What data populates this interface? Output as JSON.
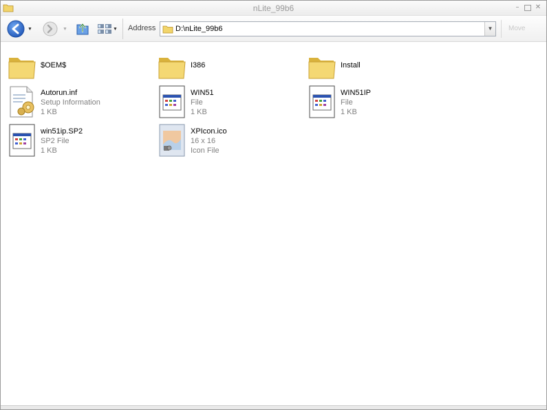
{
  "window": {
    "title": "nLite_99b6"
  },
  "toolbar": {
    "address_label": "Address",
    "address_value": "D:\\nLite_99b6",
    "go_label": "Move"
  },
  "files": [
    {
      "name": "$OEM$",
      "type": "",
      "size": "",
      "icon": "folder-icon"
    },
    {
      "name": "I386",
      "type": "",
      "size": "",
      "icon": "folder-icon"
    },
    {
      "name": "Install",
      "type": "",
      "size": "",
      "icon": "folder-icon"
    },
    {
      "name": "Autorun.inf",
      "type": "Setup Information",
      "size": "1 KB",
      "icon": "setup-info-icon"
    },
    {
      "name": "WIN51",
      "type": "File",
      "size": "1 KB",
      "icon": "generic-file-icon"
    },
    {
      "name": "WIN51IP",
      "type": "File",
      "size": "1 KB",
      "icon": "generic-file-icon"
    },
    {
      "name": "win51ip.SP2",
      "type": "SP2 File",
      "size": "1 KB",
      "icon": "generic-file-icon"
    },
    {
      "name": "XPIcon.ico",
      "type": "16 x 16",
      "size": "Icon File",
      "icon": "icon-file-icon"
    }
  ],
  "colors": {
    "folder": "#f2d56b",
    "folder_dark": "#d9b23c",
    "back_button": "#2f6fd0",
    "accent_text": "#808080"
  }
}
